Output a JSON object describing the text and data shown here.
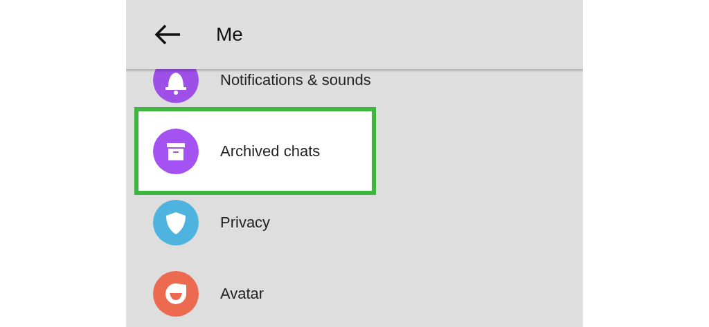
{
  "header": {
    "title": "Me"
  },
  "items": [
    {
      "kind": "bell",
      "label": "Notifications & sounds",
      "color": "#9d4fe8",
      "selected": false
    },
    {
      "kind": "archive",
      "label": "Archived chats",
      "color": "#a552f2",
      "selected": true
    },
    {
      "kind": "shield",
      "label": "Privacy",
      "color": "#4fb3e0",
      "selected": false
    },
    {
      "kind": "avatar",
      "label": "Avatar",
      "color": "#ec6a50",
      "selected": false
    }
  ]
}
